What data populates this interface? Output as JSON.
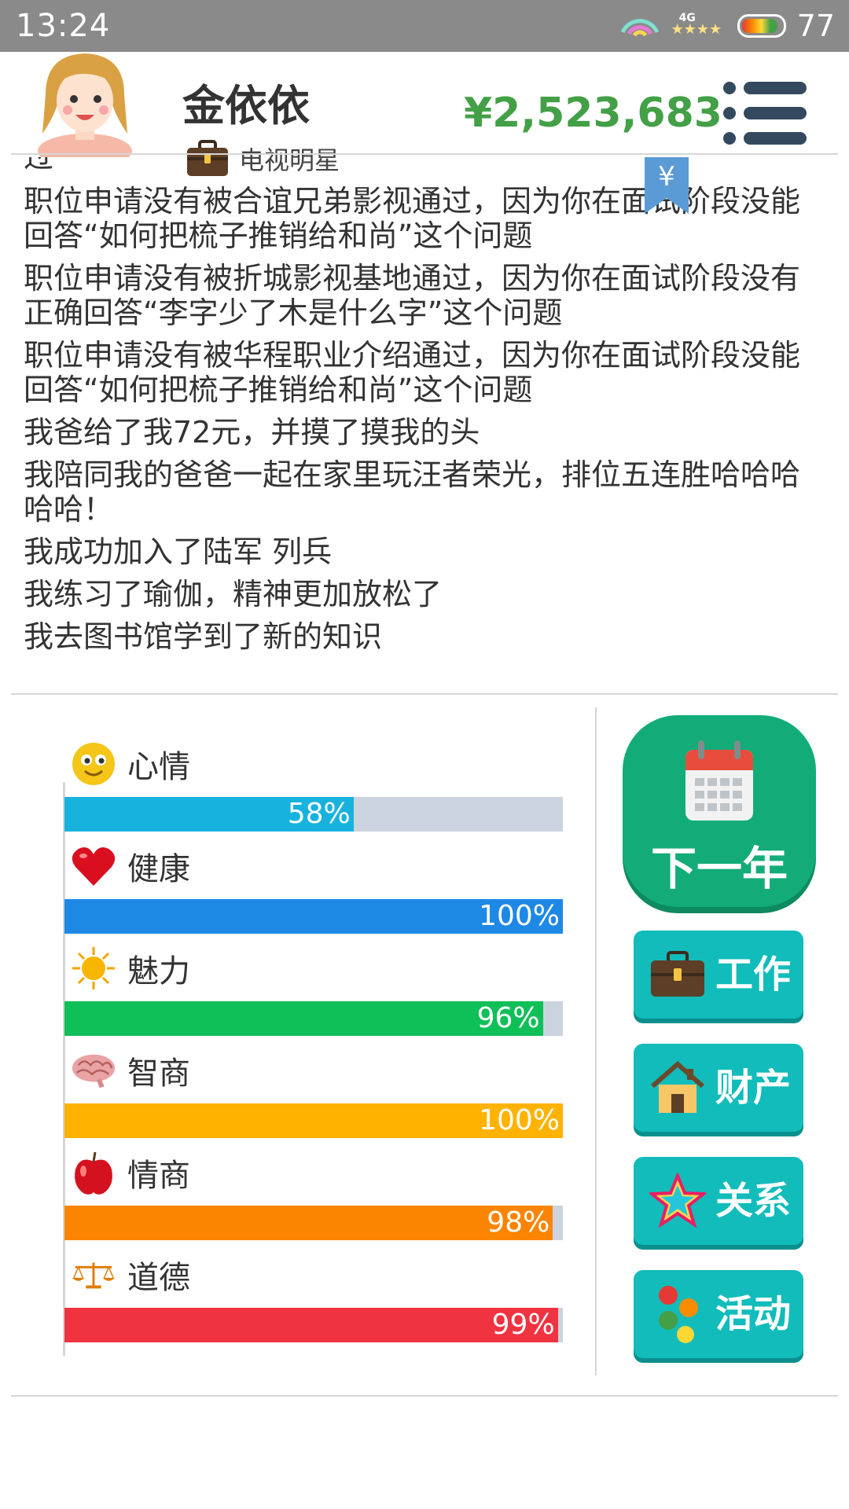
{
  "status_bar": {
    "time": "13:24",
    "network": "4G",
    "battery": "77"
  },
  "header": {
    "name": "金依依",
    "job": "电视明星",
    "money": "¥2,523,683"
  },
  "log": {
    "partial_top": "过",
    "entries": [
      "职位申请没有被合谊兄弟影视通过，因为你在面试阶段没能回答“如何把梳子推销给和尚”这个问题",
      "职位申请没有被折城影视基地通过，因为你在面试阶段没有正确回答“李字少了木是什么字”这个问题",
      "职位申请没有被华程职业介绍通过，因为你在面试阶段没能回答“如何把梳子推销给和尚”这个问题",
      "我爸给了我72元，并摸了摸我的头",
      "我陪同我的爸爸一起在家里玩汪者荣光，排位五连胜哈哈哈哈哈！",
      "我成功加入了陆军 列兵",
      "我练习了瑜伽，精神更加放松了",
      "我去图书馆学到了新的知识"
    ],
    "flag_symbol": "¥"
  },
  "stats": [
    {
      "label": "心情",
      "icon": "smiley-icon",
      "value": 58,
      "display": "58%",
      "color": "#17b2dd"
    },
    {
      "label": "健康",
      "icon": "heart-icon",
      "value": 100,
      "display": "100%",
      "color": "#1e88e5"
    },
    {
      "label": "魅力",
      "icon": "sun-icon",
      "value": 96,
      "display": "96%",
      "color": "#0fbf58"
    },
    {
      "label": "智商",
      "icon": "brain-icon",
      "value": 100,
      "display": "100%",
      "color": "#ffb300"
    },
    {
      "label": "情商",
      "icon": "apple-icon",
      "value": 98,
      "display": "98%",
      "color": "#fb8500"
    },
    {
      "label": "道德",
      "icon": "scales-icon",
      "value": 99,
      "display": "99%",
      "color": "#ef3340"
    }
  ],
  "buttons": {
    "next_year": "下一年",
    "work": "工作",
    "property": "财产",
    "relations": "关系",
    "activities": "活动"
  }
}
